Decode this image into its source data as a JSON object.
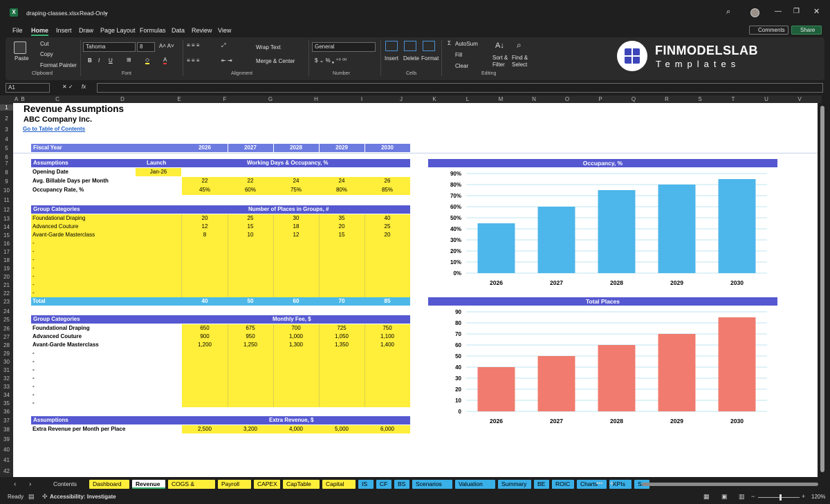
{
  "window": {
    "filename": "draping-classes.xlsx",
    "mode": "Read-Only"
  },
  "menu": [
    "File",
    "Home",
    "Insert",
    "Draw",
    "Page Layout",
    "Formulas",
    "Data",
    "Review",
    "View"
  ],
  "actions": {
    "comments": "Comments",
    "share": "Share"
  },
  "ribbon": {
    "clipboard": {
      "paste": "Paste",
      "cut": "Cut",
      "copy": "Copy",
      "format_painter": "Format Painter",
      "label": "Clipboard"
    },
    "font": {
      "name": "Tahoma",
      "size": "8",
      "label": "Font"
    },
    "alignment": {
      "wrap": "Wrap Text",
      "merge": "Merge & Center",
      "label": "Alignment"
    },
    "number": {
      "format": "General",
      "label": "Number"
    },
    "cells": {
      "insert": "Insert",
      "delete": "Delete",
      "format": "Format",
      "label": "Cells"
    },
    "editing": {
      "autosum": "AutoSum",
      "fill": "Fill",
      "clear": "Clear",
      "sort": "Sort & Filter",
      "find": "Find & Select",
      "label": "Editing"
    }
  },
  "brand": {
    "name": "FINMODELSLAB",
    "sub": "Templates"
  },
  "formula_bar": {
    "name_box": "A1",
    "fx": "fx",
    "content": ""
  },
  "columns": [
    "A",
    "B",
    "C",
    "D",
    "E",
    "F",
    "G",
    "H",
    "I",
    "J",
    "K",
    "L",
    "M",
    "N",
    "O",
    "P",
    "Q",
    "R",
    "S",
    "T",
    "U",
    "V"
  ],
  "rows": [
    "1",
    "2",
    "3",
    "4",
    "5",
    "6",
    "7",
    "8",
    "9",
    "10",
    "11",
    "12",
    "13",
    "14",
    "15",
    "16",
    "17",
    "18",
    "19",
    "20",
    "21",
    "22",
    "23",
    "24",
    "25",
    "26",
    "27",
    "28",
    "29",
    "30",
    "31",
    "32",
    "33",
    "34",
    "35",
    "36",
    "37",
    "38",
    "39",
    "40",
    "41",
    "42"
  ],
  "sheet": {
    "title": "Revenue Assumptions",
    "company": "ABC Company Inc.",
    "link": "Go to Table of Contents",
    "fiscal_year": "Fiscal Year",
    "years": [
      "2026",
      "2027",
      "2028",
      "2029",
      "2030"
    ],
    "assumptions": "Assumptions",
    "launch": "Launch",
    "working_header": "Working Days & Occupancy, %",
    "opening_date": "Opening Date",
    "opening_value": "Jan-26",
    "billable_label": "Avg. Billable Days per Month",
    "billable": [
      "22",
      "22",
      "24",
      "24",
      "26"
    ],
    "occupancy_label": "Occupancy Rate, %",
    "occupancy": [
      "45%",
      "60%",
      "75%",
      "80%",
      "85%"
    ],
    "group_categories": "Group Categories",
    "places_header": "Number of Places in Groups, #",
    "groups": [
      "Foundational Draping",
      "Advanced Couture",
      "Avant-Garde Masterclass"
    ],
    "places": [
      [
        "20",
        "25",
        "30",
        "35",
        "40"
      ],
      [
        "12",
        "15",
        "18",
        "20",
        "25"
      ],
      [
        "8",
        "10",
        "12",
        "15",
        "20"
      ]
    ],
    "dash": "-",
    "total": "Total",
    "totals": [
      "40",
      "50",
      "60",
      "70",
      "85"
    ],
    "fee_header": "Monthly Fee, $",
    "fees": [
      [
        "650",
        "675",
        "700",
        "725",
        "750"
      ],
      [
        "900",
        "950",
        "1,000",
        "1,050",
        "1,100"
      ],
      [
        "1,200",
        "1,250",
        "1,300",
        "1,350",
        "1,400"
      ]
    ],
    "extra_header": "Extra Revenue, $",
    "extra_label": "Extra Revenue per Month per Place",
    "extra": [
      "2,500",
      "3,200",
      "4,000",
      "5,000",
      "6,000"
    ]
  },
  "chart_data": [
    {
      "type": "bar",
      "title": "Occupancy, %",
      "categories": [
        "2026",
        "2027",
        "2028",
        "2029",
        "2030"
      ],
      "values": [
        45,
        60,
        75,
        80,
        85
      ],
      "ylim": [
        0,
        90
      ],
      "yticks": [
        "0%",
        "10%",
        "20%",
        "30%",
        "40%",
        "50%",
        "60%",
        "70%",
        "80%",
        "90%"
      ],
      "color": "#4db6ea",
      "grid": true
    },
    {
      "type": "bar",
      "title": "Total Places",
      "categories": [
        "2026",
        "2027",
        "2028",
        "2029",
        "2030"
      ],
      "values": [
        40,
        50,
        60,
        70,
        85
      ],
      "ylim": [
        0,
        90
      ],
      "yticks": [
        "0",
        "10",
        "20",
        "30",
        "40",
        "50",
        "60",
        "70",
        "80",
        "90"
      ],
      "color": "#f07b6e",
      "grid": true
    }
  ],
  "tabs": [
    {
      "label": "Contents",
      "color": "#1f1f1f",
      "text": "#ddd"
    },
    {
      "label": "Dashboard",
      "color": "#ffee3a",
      "text": "#000"
    },
    {
      "label": "Revenue",
      "color": "#ffffff",
      "text": "#000",
      "active": true
    },
    {
      "label": "COGS & OPEX",
      "color": "#ffee3a",
      "text": "#000"
    },
    {
      "label": "Payroll",
      "color": "#ffee3a",
      "text": "#000"
    },
    {
      "label": "CAPEX",
      "color": "#ffee3a",
      "text": "#000"
    },
    {
      "label": "CapTable",
      "color": "#ffee3a",
      "text": "#000"
    },
    {
      "label": "Capital",
      "color": "#ffee3a",
      "text": "#000"
    },
    {
      "label": "IS",
      "color": "#3ab0e8",
      "text": "#000"
    },
    {
      "label": "CF",
      "color": "#3ab0e8",
      "text": "#000"
    },
    {
      "label": "BS",
      "color": "#3ab0e8",
      "text": "#000"
    },
    {
      "label": "Scenarios",
      "color": "#3ab0e8",
      "text": "#000"
    },
    {
      "label": "Valuation",
      "color": "#3ab0e8",
      "text": "#000"
    },
    {
      "label": "Summary",
      "color": "#3ab0e8",
      "text": "#000"
    },
    {
      "label": "BE",
      "color": "#3ab0e8",
      "text": "#000"
    },
    {
      "label": "ROIC",
      "color": "#3ab0e8",
      "text": "#000"
    },
    {
      "label": "Charts",
      "color": "#3ab0e8",
      "text": "#000"
    },
    {
      "label": "KPIs",
      "color": "#3ab0e8",
      "text": "#000"
    },
    {
      "label": "Sı",
      "color": "#3ab0e8",
      "text": "#000"
    }
  ],
  "status": {
    "ready": "Ready",
    "accessibility": "Accessibility: Investigate",
    "zoom": "120%"
  }
}
